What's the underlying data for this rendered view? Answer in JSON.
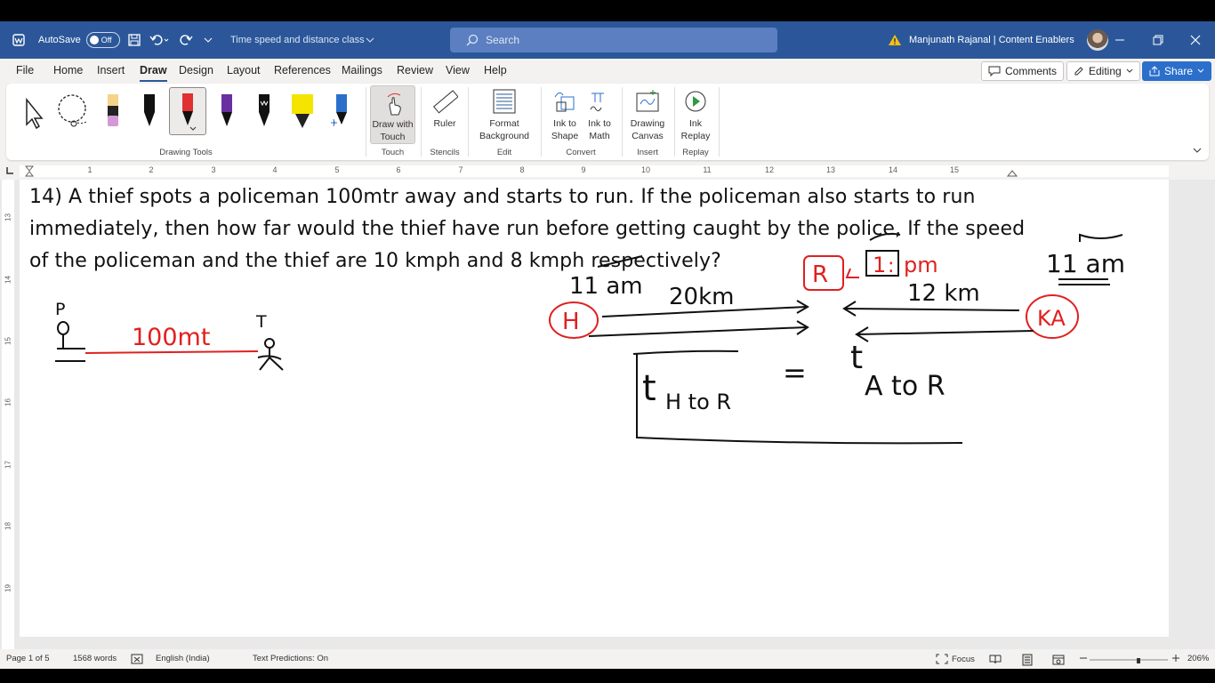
{
  "titlebar": {
    "autosave_label": "AutoSave",
    "autosave_state": "Off",
    "doc_title": "Time speed and distance class",
    "search_placeholder": "Search",
    "user_name": "Manjunath Rajanal | Content Enablers"
  },
  "menu": {
    "items": [
      "File",
      "Home",
      "Insert",
      "Draw",
      "Design",
      "Layout",
      "References",
      "Mailings",
      "Review",
      "View",
      "Help"
    ],
    "comments_label": "Comments",
    "editing_label": "Editing",
    "share_label": "Share"
  },
  "ribbon": {
    "drawing_tools_label": "Drawing Tools",
    "touch": {
      "button": "Draw with Touch",
      "group": "Touch"
    },
    "stencils": {
      "button": "Ruler",
      "group": "Stencils"
    },
    "edit": {
      "button": "Format Background",
      "group": "Edit"
    },
    "convert": {
      "ink_to_shape": "Ink to Shape",
      "ink_to_math": "Ink to Math",
      "group": "Convert"
    },
    "insert": {
      "button": "Drawing Canvas",
      "group": "Insert"
    },
    "replay": {
      "button": "Ink Replay",
      "group": "Replay"
    },
    "pen_colors": [
      "#000000",
      "#e03030",
      "#6a2fa0",
      "#000000",
      "#f5e400",
      "#2b6fcb"
    ]
  },
  "ruler": {
    "h_numbers": [
      "1",
      "2",
      "3",
      "4",
      "5",
      "6",
      "7",
      "8",
      "9",
      "10",
      "11",
      "12",
      "13",
      "14",
      "15"
    ],
    "v_numbers": [
      "13",
      "14",
      "15",
      "16",
      "17",
      "18",
      "19"
    ]
  },
  "document": {
    "question_lines": [
      "14) A thief spots a policeman 100mtr away and starts to run. If the policeman also starts to run",
      "immediately, then how far would the thief have run before getting caught by the police, If the speed",
      "of the policeman and the thief are 10 kmph and 8 kmph respectively?"
    ],
    "ink_labels": {
      "police_letter": "P",
      "thief_letter": "T",
      "distance": "100mt",
      "time_left": "11 am",
      "time_right": "11 am",
      "dist_h": "20km",
      "dist_a": "12 km",
      "city_h": "H",
      "city_ka": "KA",
      "meet_r": "R",
      "meet_time_hour": "1",
      "meet_time_suffix": "pm",
      "t_h_to_r": "H to R",
      "t_a_to_r": "A to R",
      "equals": "="
    },
    "ink_colors": {
      "black": "#111111",
      "red": "#e02020"
    }
  },
  "status": {
    "page": "Page 1 of 5",
    "words": "1568 words",
    "language": "English (India)",
    "predictions": "Text Predictions: On",
    "focus": "Focus",
    "zoom": "206%"
  }
}
